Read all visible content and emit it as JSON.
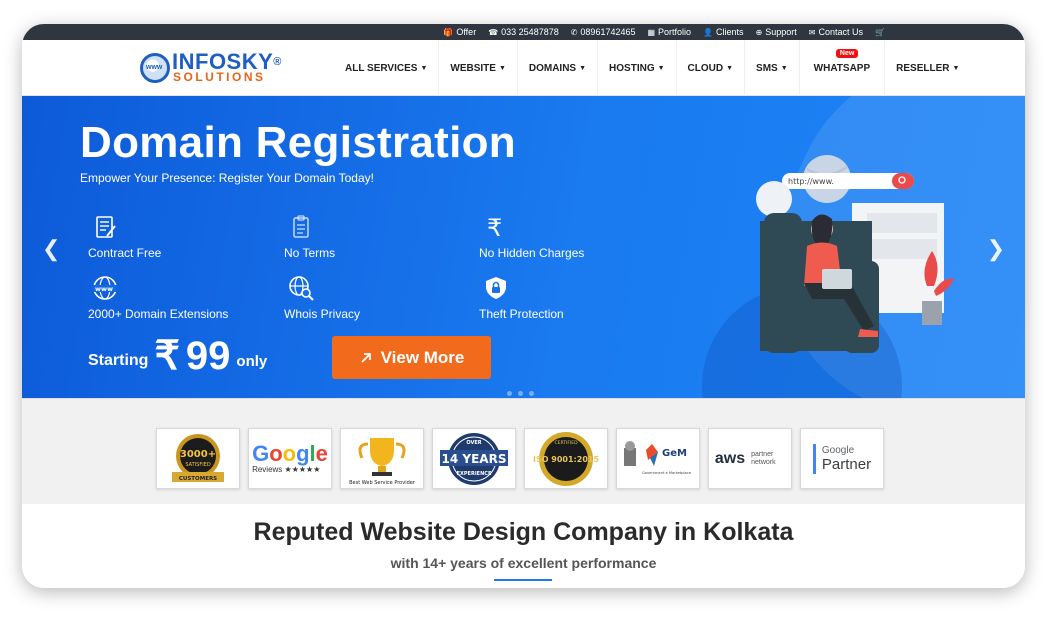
{
  "topbar": {
    "items": [
      {
        "icon": "gift-icon",
        "label": "Offer"
      },
      {
        "icon": "phone-icon",
        "label": "033 25487878"
      },
      {
        "icon": "whatsapp-icon",
        "label": "08961742465"
      },
      {
        "icon": "grid-icon",
        "label": "Portfolio"
      },
      {
        "icon": "user-icon",
        "label": "Clients"
      },
      {
        "icon": "support-icon",
        "label": "Support"
      },
      {
        "icon": "envelope-icon",
        "label": "Contact Us"
      },
      {
        "icon": "cart-icon",
        "label": ""
      }
    ]
  },
  "logo": {
    "name": "INFOSKY",
    "reg": "®",
    "tagline": "SOLUTIONS",
    "globe_text": "www"
  },
  "nav": {
    "items": [
      {
        "label": "ALL SERVICES"
      },
      {
        "label": "WEBSITE"
      },
      {
        "label": "DOMAINS"
      },
      {
        "label": "HOSTING"
      },
      {
        "label": "CLOUD"
      },
      {
        "label": "SMS"
      },
      {
        "label": "WHATSAPP",
        "badge": "New"
      },
      {
        "label": "RESELLER"
      }
    ]
  },
  "hero": {
    "title": "Domain Registration",
    "subtitle": "Empower Your Presence: Register Your Domain Today!",
    "features": [
      {
        "icon": "contract-icon",
        "label": "Contract Free"
      },
      {
        "icon": "clipboard-icon",
        "label": "No Terms"
      },
      {
        "icon": "rupee-icon",
        "label": "No Hidden Charges"
      },
      {
        "icon": "www-globe-icon",
        "label": "2000+ Domain Extensions"
      },
      {
        "icon": "globe-search-icon",
        "label": "Whois Privacy"
      },
      {
        "icon": "shield-lock-icon",
        "label": "Theft Protection"
      }
    ],
    "price_prefix": "Starting",
    "currency": "₹",
    "price": "99",
    "price_suffix": "only",
    "cta": "View More",
    "search_placeholder": "http://www.",
    "colors": {
      "accent": "#f26a1b",
      "hero_bg": "#1a7af0"
    }
  },
  "badges": [
    {
      "name": "satisfied-customers-badge",
      "line1": "3000+",
      "line2": "SATISFIED",
      "line3": "CUSTOMERS"
    },
    {
      "name": "google-reviews-badge",
      "line1": "Google",
      "line2": "Reviews ★★★★★"
    },
    {
      "name": "best-web-service-badge",
      "line1": "Best Web Service Provider"
    },
    {
      "name": "14-years-badge",
      "line1": "OVER",
      "line2": "14 YEARS",
      "line3": "EXPERIENCE"
    },
    {
      "name": "iso-badge",
      "line1": "CERTIFIED",
      "line2": "ISO 9001:2015"
    },
    {
      "name": "gem-badge",
      "line1": "GeM",
      "line2": "Government e Marketplace"
    },
    {
      "name": "aws-badge",
      "line1": "aws",
      "line2": "partner network"
    },
    {
      "name": "google-partner-badge",
      "line1": "Google",
      "line2": "Partner"
    }
  ],
  "bottom": {
    "title": "Reputed Website Design Company in Kolkata",
    "subtitle": "with 14+ years of excellent performance"
  }
}
